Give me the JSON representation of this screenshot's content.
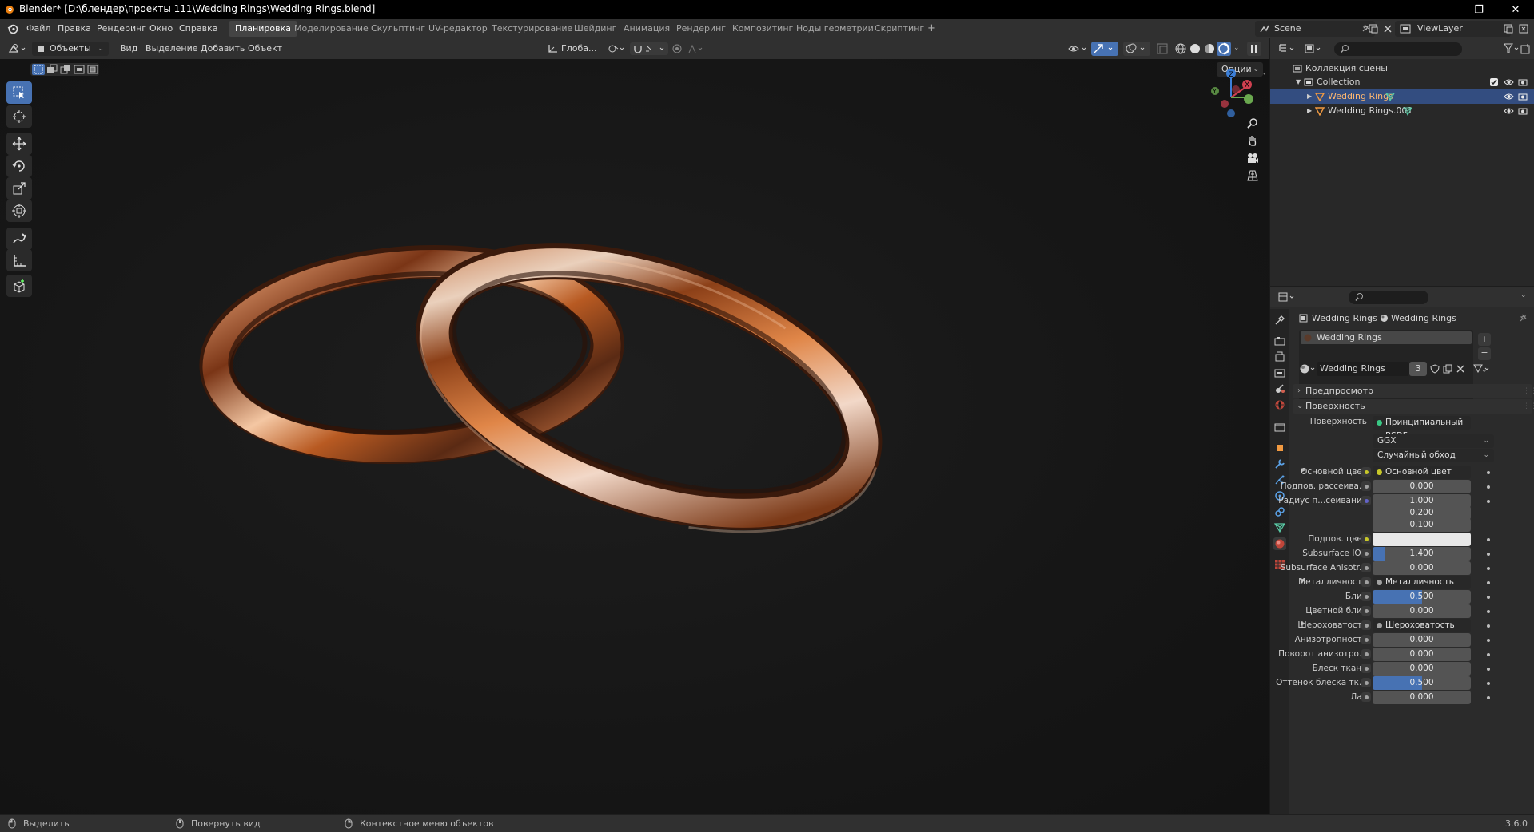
{
  "window": {
    "title": "Blender* [D:\\блендер\\проекты 111\\Wedding Rings\\Wedding Rings.blend]",
    "controls": [
      "—",
      "❐",
      "✕"
    ]
  },
  "menu": {
    "items": [
      "Файл",
      "Правка",
      "Рендеринг",
      "Окно",
      "Справка"
    ]
  },
  "workspaces": {
    "tabs": [
      "Планировка",
      "Моделирование",
      "Скульптинг",
      "UV-редактор",
      "Текстурирование",
      "Шейдинг",
      "Анимация",
      "Рендеринг",
      "Композитинг",
      "Ноды геометрии",
      "Скриптинг"
    ],
    "active": "Планировка",
    "add": "+"
  },
  "scene": {
    "name": "Scene",
    "view_layer": "ViewLayer"
  },
  "viewport_header": {
    "mode": "Объекты",
    "menus": [
      "Вид",
      "Выделение",
      "Добавить",
      "Объект"
    ],
    "transform_orientation": "Глоба...",
    "options": "Опции"
  },
  "outliner": {
    "root": "Коллекция сцены",
    "collection": "Collection",
    "objects": [
      "Wedding Rings",
      "Wedding Rings.001"
    ],
    "selected": "Wedding Rings"
  },
  "properties": {
    "breadcrumb": [
      "Wedding Rings",
      "Wedding Rings"
    ],
    "slot": "Wedding Rings",
    "material_name": "Wedding Rings",
    "users": "3",
    "panels": {
      "preview": "Предпросмотр",
      "surface": "Поверхность"
    },
    "surface": {
      "label": "Поверхность",
      "value": "Принципиальный BSDF"
    },
    "distribution": "GGX",
    "subsurface_method": "Случайный обход",
    "fields": [
      {
        "label": "Основной цвет",
        "type": "link",
        "value": "Основной цвет",
        "expand": true,
        "socket": "#c7c729"
      },
      {
        "label": "Подпов. рассеива...",
        "type": "num",
        "value": "0.000",
        "fill": 0,
        "socket": "#a1a1a1"
      },
      {
        "label": "Радиус п...сеивания",
        "type": "num",
        "value": "1.000",
        "fill": 0,
        "socket": "#6363c7"
      },
      {
        "label": "",
        "type": "num",
        "value": "0.200",
        "fill": 0
      },
      {
        "label": "",
        "type": "num",
        "value": "0.100",
        "fill": 0
      },
      {
        "label": "Подпов. цвет",
        "type": "color",
        "value": "",
        "color": "#e8e8e8",
        "socket": "#c7c729"
      },
      {
        "label": "Subsurface IOR",
        "type": "num",
        "value": "1.400",
        "fill": 0.12,
        "socket": "#a1a1a1"
      },
      {
        "label": "Subsurface Anisotr...",
        "type": "num",
        "value": "0.000",
        "fill": 0,
        "socket": "#a1a1a1"
      },
      {
        "label": "Металличность",
        "type": "link",
        "value": "Металличность",
        "expand": true,
        "socket": "#a1a1a1"
      },
      {
        "label": "Блик",
        "type": "num",
        "value": "0.500",
        "fill": 0.5,
        "socket": "#a1a1a1"
      },
      {
        "label": "Цветной блик",
        "type": "num",
        "value": "0.000",
        "fill": 0,
        "socket": "#a1a1a1"
      },
      {
        "label": "Шероховатость",
        "type": "link",
        "value": "Шероховатость",
        "expand": true,
        "socket": "#a1a1a1"
      },
      {
        "label": "Анизотропность",
        "type": "num",
        "value": "0.000",
        "fill": 0,
        "socket": "#a1a1a1"
      },
      {
        "label": "Поворот анизотро...",
        "type": "num",
        "value": "0.000",
        "fill": 0,
        "socket": "#a1a1a1"
      },
      {
        "label": "Блеск ткани",
        "type": "num",
        "value": "0.000",
        "fill": 0,
        "socket": "#a1a1a1"
      },
      {
        "label": "Оттенок блеска тк...",
        "type": "num",
        "value": "0.500",
        "fill": 0.5,
        "socket": "#a1a1a1"
      },
      {
        "label": "Лак",
        "type": "num",
        "value": "0.000",
        "fill": 0,
        "socket": "#a1a1a1"
      }
    ]
  },
  "statusbar": {
    "select": "Выделить",
    "rotate": "Повернуть вид",
    "context": "Контекстное меню объектов",
    "version": "3.6.0"
  },
  "colors": {
    "accent": "#4772b3",
    "selection": "#334d80",
    "ring": "#b8602a"
  }
}
